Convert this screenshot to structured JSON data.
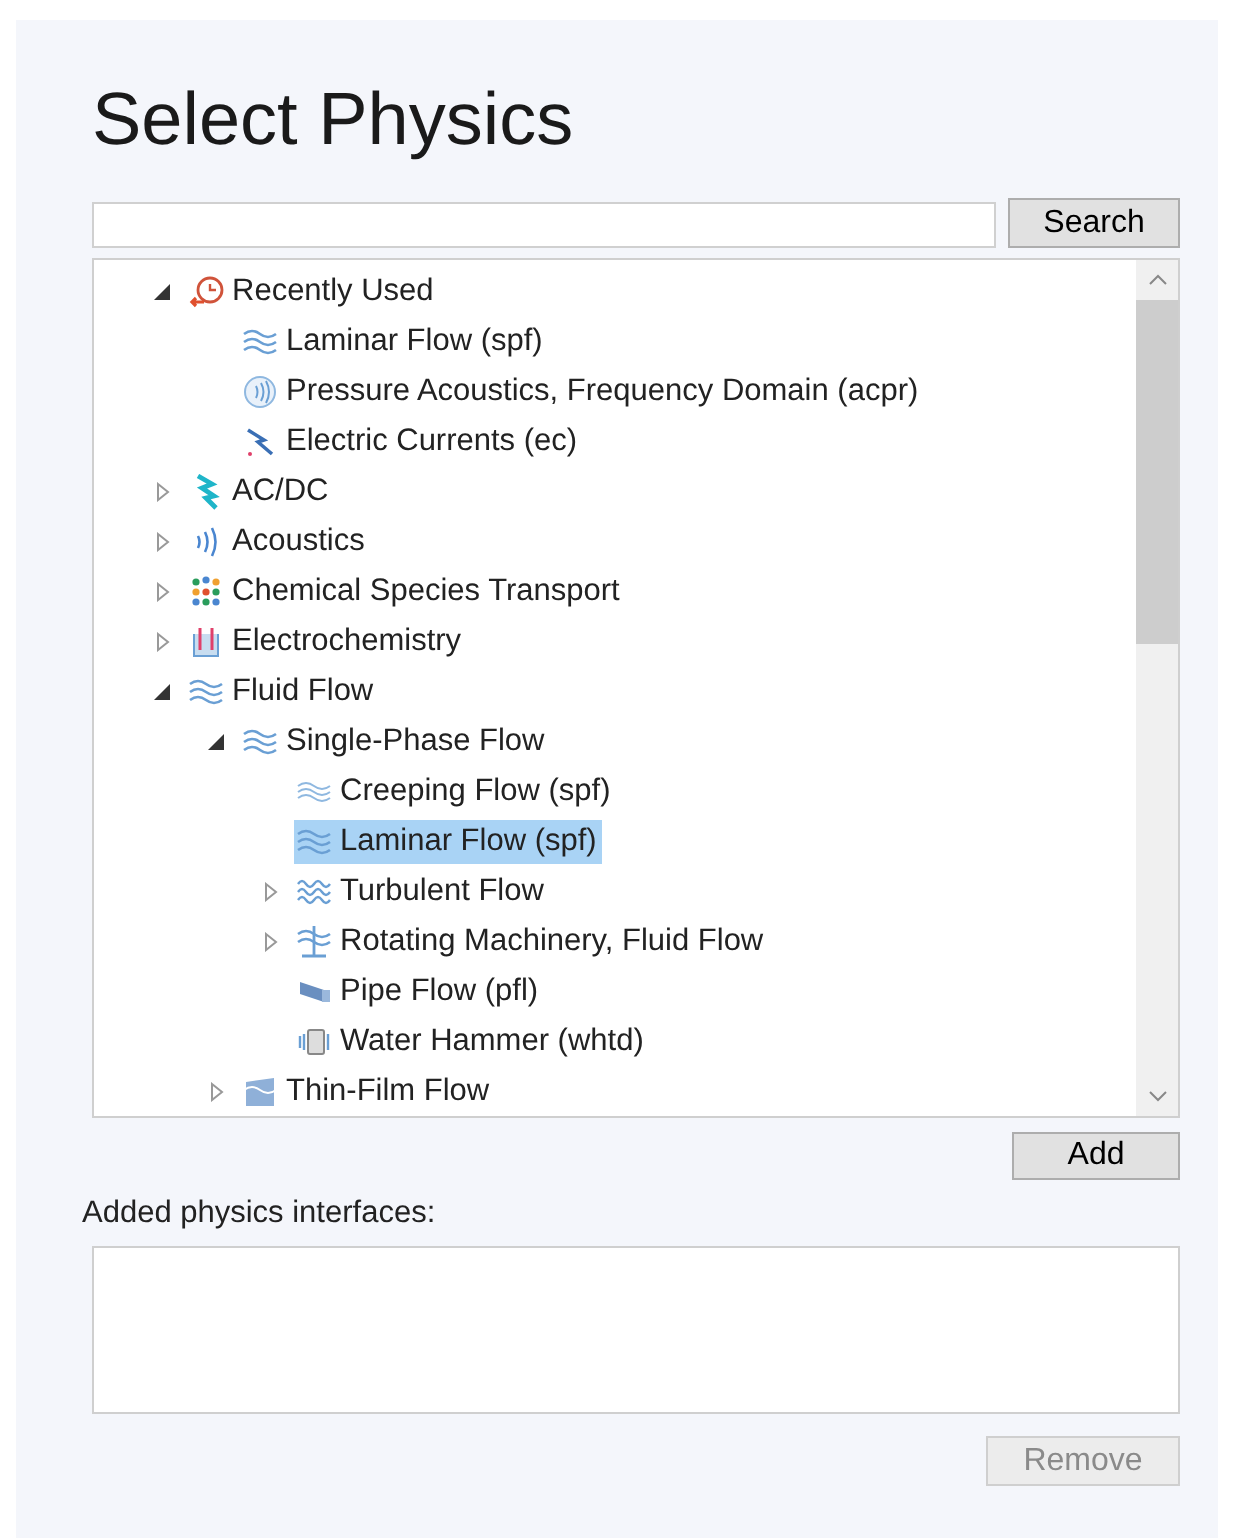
{
  "title": "Select Physics",
  "search": {
    "button": "Search"
  },
  "tree": [
    {
      "label": "Recently Used",
      "kind": "clock",
      "expanded": true,
      "selected": false,
      "children": [
        {
          "label": "Laminar Flow (spf)",
          "kind": "waves",
          "selected": false
        },
        {
          "label": "Pressure Acoustics, Frequency Domain (acpr)",
          "kind": "acoustic",
          "selected": false
        },
        {
          "label": "Electric Currents (ec)",
          "kind": "current",
          "selected": false
        }
      ]
    },
    {
      "label": "AC/DC",
      "kind": "bolt",
      "expanded": false,
      "selected": false
    },
    {
      "label": "Acoustics",
      "kind": "sound",
      "expanded": false,
      "selected": false
    },
    {
      "label": "Chemical Species Transport",
      "kind": "dots",
      "expanded": false,
      "selected": false
    },
    {
      "label": "Electrochemistry",
      "kind": "beaker",
      "expanded": false,
      "selected": false
    },
    {
      "label": "Fluid Flow",
      "kind": "waves",
      "expanded": true,
      "selected": false,
      "children": [
        {
          "label": "Single-Phase Flow",
          "kind": "waves",
          "expanded": true,
          "selected": false,
          "children": [
            {
              "label": "Creeping Flow (spf)",
              "kind": "creeping",
              "selected": false
            },
            {
              "label": "Laminar Flow (spf)",
              "kind": "waves",
              "selected": true
            },
            {
              "label": "Turbulent Flow",
              "kind": "turbulent",
              "expanded": false,
              "selected": false
            },
            {
              "label": "Rotating Machinery, Fluid Flow",
              "kind": "rotor",
              "expanded": false,
              "selected": false
            },
            {
              "label": "Pipe Flow (pfl)",
              "kind": "pipe",
              "selected": false
            },
            {
              "label": "Water Hammer (whtd)",
              "kind": "hammer",
              "selected": false
            }
          ]
        },
        {
          "label": "Thin-Film Flow",
          "kind": "film",
          "expanded": false,
          "selected": false
        }
      ]
    }
  ],
  "add_button": "Add",
  "added_label": "Added physics interfaces:",
  "remove_button": {
    "label": "Remove",
    "disabled": true
  }
}
